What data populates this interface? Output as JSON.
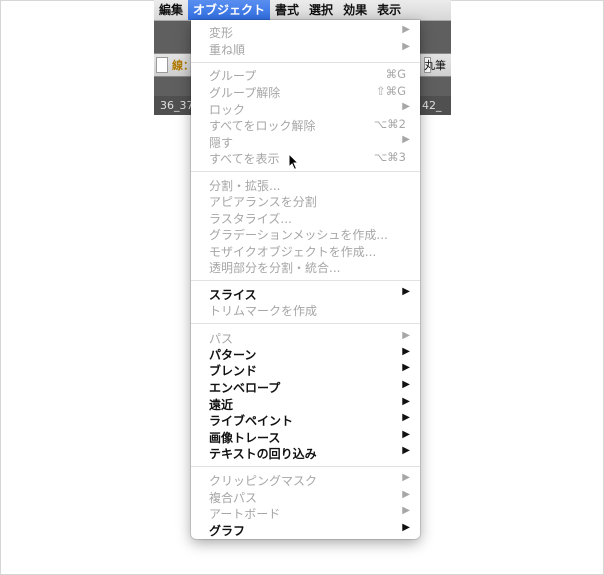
{
  "menubar": {
    "items": [
      "編集",
      "オブジェクト",
      "書式",
      "選択",
      "効果",
      "表示"
    ],
    "active_index": 1
  },
  "background": {
    "control_label": "線：",
    "font_label": "丸筆",
    "tab_left": "36_37",
    "tab_right": "42_"
  },
  "menu": {
    "transform": "変形",
    "arrange": "重ね順",
    "group": "グループ",
    "group_sc": "⌘G",
    "ungroup": "グループ解除",
    "ungroup_sc": "⇧⌘G",
    "lock": "ロック",
    "unlock_all": "すべてをロック解除",
    "unlock_all_sc": "⌥⌘2",
    "hide": "隠す",
    "show_all": "すべてを表示",
    "show_all_sc": "⌥⌘3",
    "expand": "分割・拡張...",
    "expand_appearance": "アピアランスを分割",
    "rasterize": "ラスタライズ...",
    "gradient_mesh": "グラデーションメッシュを作成...",
    "mosaic": "モザイクオブジェクトを作成...",
    "flatten": "透明部分を分割・統合...",
    "slice": "スライス",
    "trim_marks": "トリムマークを作成",
    "path": "パス",
    "pattern": "パターン",
    "blend": "ブレンド",
    "envelope": "エンベロープ",
    "perspective": "遠近",
    "live_paint": "ライブペイント",
    "image_trace": "画像トレース",
    "text_wrap": "テキストの回り込み",
    "clipping_mask": "クリッピングマスク",
    "compound_path": "複合パス",
    "artboards": "アートボード",
    "graph": "グラフ"
  },
  "arrow_glyph": "▶"
}
